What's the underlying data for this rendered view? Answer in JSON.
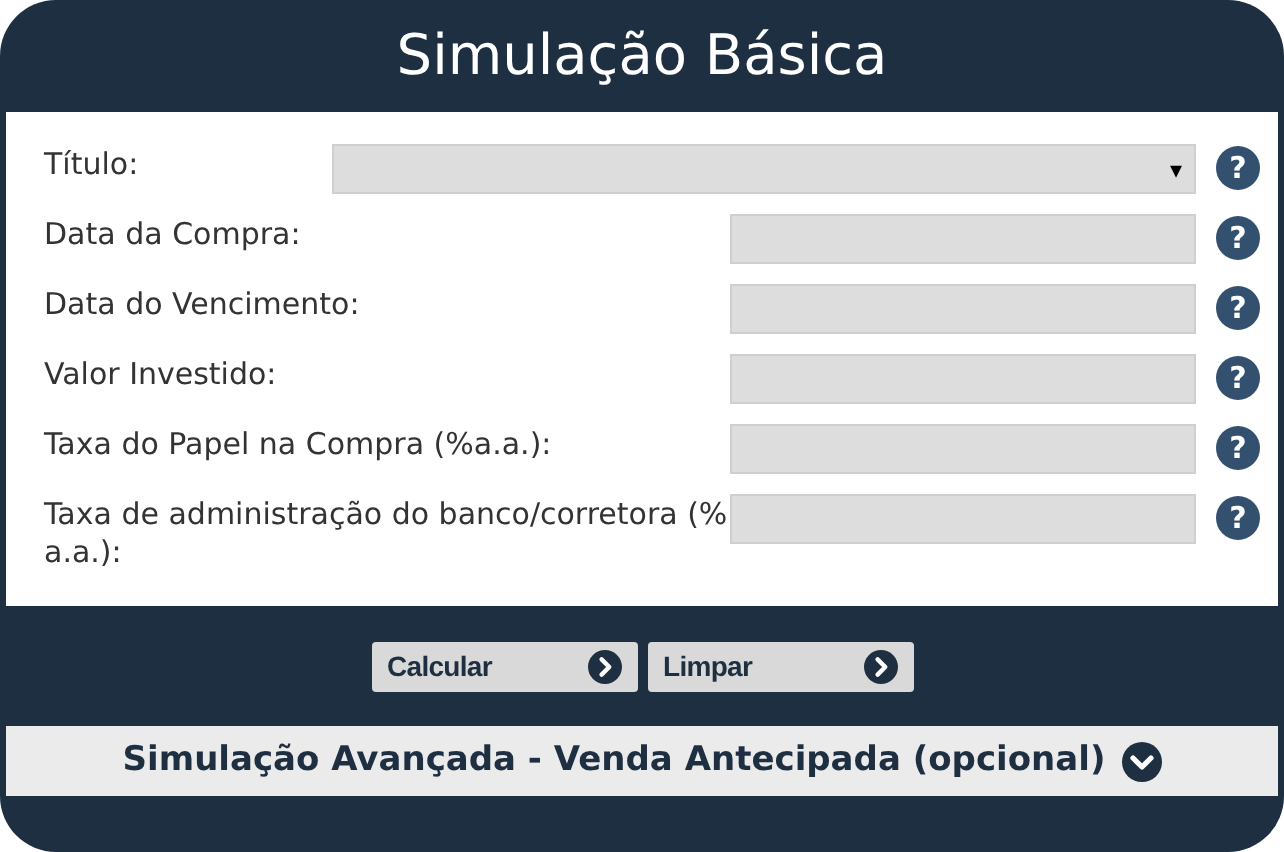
{
  "title": "Simulação Básica",
  "fields": [
    {
      "kind": "select",
      "label": "Título:",
      "help": "?",
      "dropdown_arrow": "▾"
    },
    {
      "kind": "text",
      "label": "Data da Compra:",
      "help": "?"
    },
    {
      "kind": "text",
      "label": "Data do Vencimento:",
      "help": "?"
    },
    {
      "kind": "text",
      "label": "Valor Investido:",
      "help": "?"
    },
    {
      "kind": "text",
      "label": "Taxa do Papel na Compra (%a.a.):",
      "help": "?"
    },
    {
      "kind": "text",
      "label": "Taxa de administração do banco/corretora (% a.a.):",
      "help": "?"
    }
  ],
  "buttons": [
    "Calcular",
    "Limpar"
  ],
  "advanced": {
    "label": "Simulação Avançada - Venda Antecipada (opcional)",
    "expanded": false
  }
}
